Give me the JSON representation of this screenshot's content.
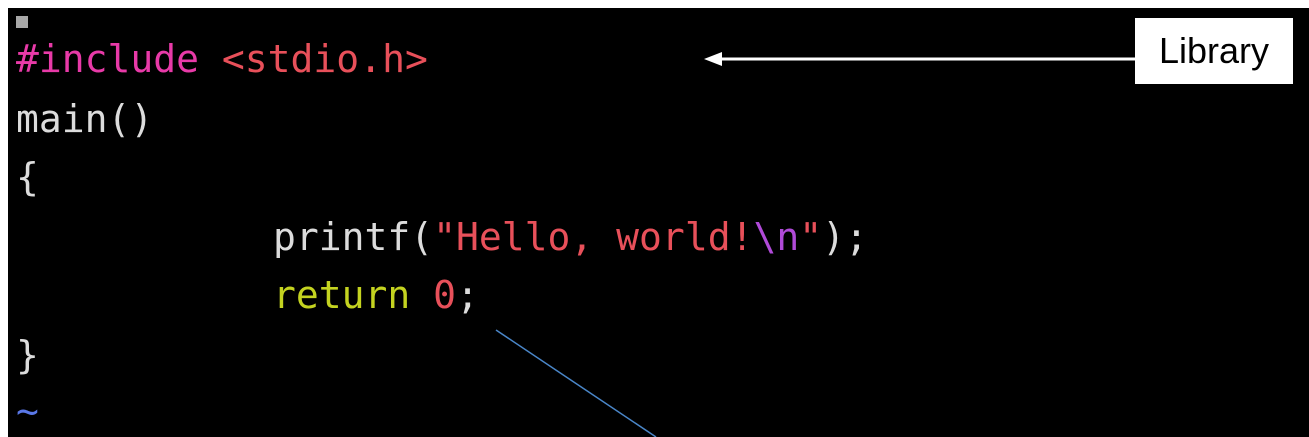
{
  "code": {
    "line1": {
      "directive": "#include",
      "header": "<stdio.h>"
    },
    "line2": "main()",
    "line3": "{",
    "line4": {
      "func": "printf(",
      "string_open": "\"Hello, world!",
      "escape": "\\n",
      "string_close": "\"",
      "end": ");"
    },
    "line5": {
      "keyword": "return",
      "number": "0",
      "end": ";"
    },
    "line6": "}",
    "line7": "~"
  },
  "annotations": {
    "library_label": "Library"
  },
  "colors": {
    "background": "#000000",
    "preprocessor": "#e83aa8",
    "string": "#e8505a",
    "escape": "#b04ad8",
    "keyword": "#c4d320",
    "tilde": "#5a78e8"
  }
}
